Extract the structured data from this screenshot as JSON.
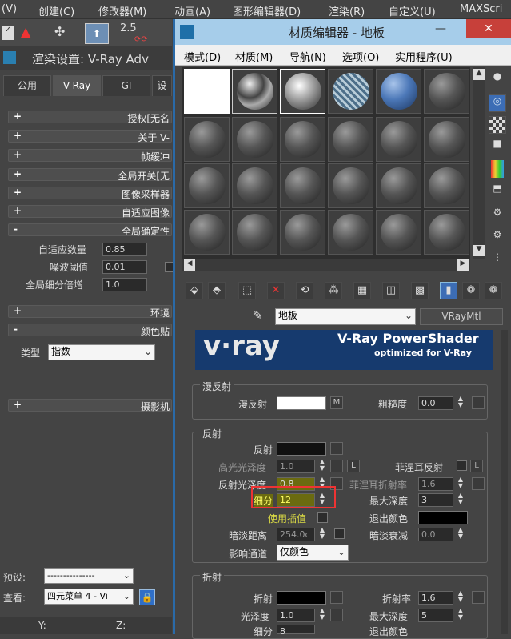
{
  "max_menu": {
    "items": [
      "(V)",
      "创建(C)",
      "修改器(M)",
      "动画(A)",
      "图形编辑器(D)",
      "渲染(R)",
      "自定义(U)",
      "MAXScri"
    ]
  },
  "max_toolbar": {
    "spin_value": "2.5"
  },
  "render_setup": {
    "title": "渲染设置: V-Ray Adv",
    "tabs": [
      "公用",
      "V-Ray",
      "GI",
      "设"
    ],
    "rollouts": [
      "授权[无名",
      "关于 V-",
      "帧缓冲",
      "全局开关[无",
      "图像采样器",
      "自适应图像",
      "全局确定性"
    ],
    "adaptive": {
      "amount_label": "自适应数量",
      "amount": "0.85",
      "noise_label": "噪波阈值",
      "noise": "0.01",
      "subdiv_label": "全局细分倍增",
      "subdiv": "1.0"
    },
    "rollouts2": [
      "环境",
      "颜色贴"
    ],
    "color_type_label": "类型",
    "color_type": "指数",
    "rollout3": "摄影机",
    "preset_label": "预设:",
    "preset_value": "---------------",
    "view_label": "查看:",
    "view_value": "四元菜单 4 - Vi",
    "status": [
      "Y:",
      "Z:"
    ]
  },
  "mat_editor": {
    "title": "材质编辑器 - 地板",
    "minimize": "—",
    "close": "✕",
    "menu": [
      "模式(D)",
      "材质(M)",
      "导航(N)",
      "选项(O)",
      "实用程序(U)"
    ],
    "mat_name": "地板",
    "mat_type": "VRayMtl",
    "banner_logo": "v·ray",
    "banner_title": "V-Ray PowerShader",
    "banner_sub": "optimized for V-Ray",
    "diffuse": {
      "group": "漫反射",
      "diffuse_label": "漫反射",
      "m": "M",
      "rough_label": "粗糙度",
      "rough": "0.0"
    },
    "reflect": {
      "group": "反射",
      "refl_label": "反射",
      "hilight_label": "高光光泽度",
      "hilight": "1.0",
      "L": "L",
      "fresnel_label": "菲涅耳反射",
      "gloss_label": "反射光泽度",
      "gloss": "0.8",
      "fresnel_ior_label": "菲涅耳折射率",
      "fresnel_ior": "1.6",
      "subdiv_label": "细分",
      "subdiv": "12",
      "maxdepth_label": "最大深度",
      "maxdepth": "3",
      "interp_label": "使用插值",
      "exit_label": "退出颜色",
      "dim_label": "暗淡距离",
      "dim": "254.0c",
      "dimfall_label": "暗淡衰减",
      "dimfall": "0.0",
      "channel_label": "影响通道",
      "channel": "仅颜色"
    },
    "refract": {
      "group": "折射",
      "refr_label": "折射",
      "ior_label": "折射率",
      "ior": "1.6",
      "gloss_label": "光泽度",
      "gloss": "1.0",
      "maxdepth_label": "最大深度",
      "maxdepth": "5",
      "subdiv_label": "细分",
      "subdiv": "8",
      "exit_label": "退出颜色"
    }
  }
}
